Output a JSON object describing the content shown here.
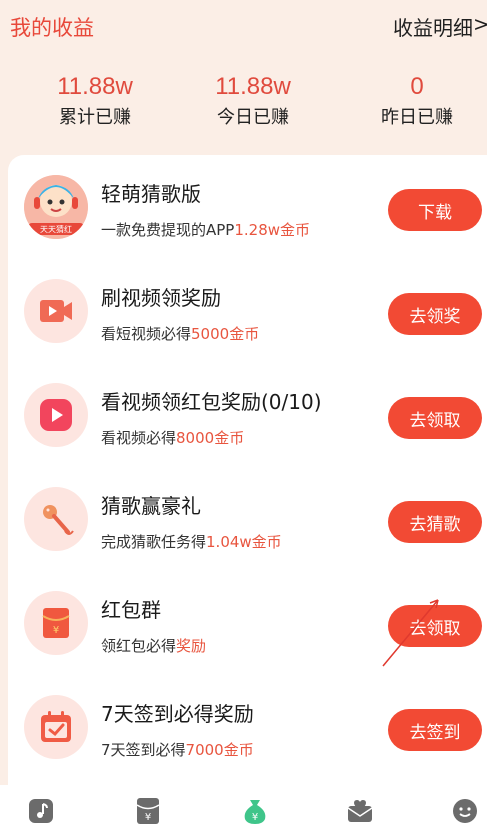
{
  "header": {
    "title": "我的收益",
    "detail_link": "收益明细",
    "detail_chevron": ">"
  },
  "stats": [
    {
      "value": "11.88w",
      "label": "累计已赚"
    },
    {
      "value": "11.88w",
      "label": "今日已赚"
    },
    {
      "value": "0",
      "label": "昨日已赚"
    }
  ],
  "tasks": [
    {
      "title": "轻萌猜歌版",
      "desc_prefix": "一款免费提现的APP",
      "desc_highlight": "1.28w金币",
      "button": "下载",
      "icon": "game-app-avatar-icon",
      "avatar_text": "天天猜红"
    },
    {
      "title": "刷视频领奖励",
      "desc_prefix": "看短视频必得",
      "desc_highlight": "5000金币",
      "button": "去领奖",
      "icon": "video-play-icon"
    },
    {
      "title": "看视频领红包奖励(0/10)",
      "desc_prefix": "看视频必得",
      "desc_highlight": "8000金币",
      "button": "去领取",
      "icon": "play-button-icon"
    },
    {
      "title": "猜歌赢豪礼",
      "desc_prefix": "完成猜歌任务得",
      "desc_highlight": "1.04w金币",
      "button": "去猜歌",
      "icon": "microphone-icon"
    },
    {
      "title": "红包群",
      "desc_prefix": "领红包必得",
      "desc_highlight": "奖励",
      "button": "去领取",
      "icon": "red-envelope-icon",
      "envelope_symbol": "¥"
    },
    {
      "title": "7天签到必得奖励",
      "desc_prefix": "7天签到必得",
      "desc_highlight": "7000金币",
      "button": "去签到",
      "icon": "calendar-check-icon"
    }
  ],
  "bottom_nav": {
    "items": [
      {
        "icon": "music-note-icon",
        "active": false
      },
      {
        "icon": "red-envelope-icon",
        "active": false,
        "symbol": "¥"
      },
      {
        "icon": "money-bag-icon",
        "active": true,
        "symbol": "¥"
      },
      {
        "icon": "mail-heart-icon",
        "active": false
      },
      {
        "icon": "smiley-face-icon",
        "active": false
      }
    ]
  },
  "colors": {
    "accent": "#f24a34",
    "highlight": "#e8553f",
    "background": "#fbeee6",
    "active_nav": "#3fc58a"
  }
}
